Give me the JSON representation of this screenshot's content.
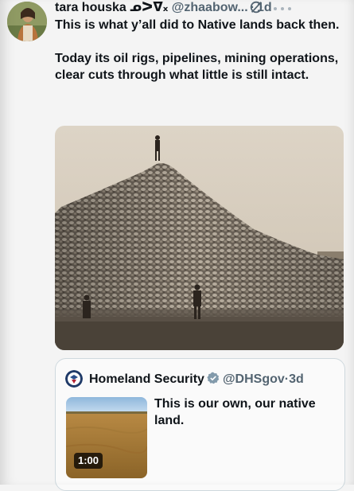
{
  "tweet": {
    "author_name": "tara houska ᓄᐳᐁ᙮",
    "handle": "@zhaabow...",
    "separator": "·",
    "time": "1d",
    "paragraphs": [
      "This is what y’all did to Native lands back then.",
      "Today its oil rigs, pipelines, mining operations, clear cuts through what little is still intact."
    ],
    "avatar_icon": "profile-photo",
    "grok_icon": "grok-icon",
    "more_icon": "more-icon"
  },
  "quote": {
    "author_name": "Homeland Security",
    "handle": "@DHSgov",
    "separator": "·",
    "time": "3d",
    "text": "This is our own, our native land.",
    "video_duration": "1:00",
    "verified_color": "#829aab"
  },
  "colors": {
    "text": "#0f1419",
    "secondary": "#536471",
    "border": "#cfd9de"
  }
}
